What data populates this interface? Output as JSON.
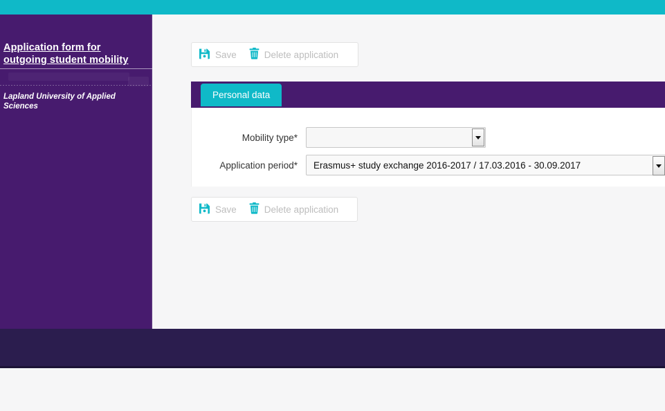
{
  "brand": {
    "teal": "#0fb9c8",
    "purple": "#471b6e",
    "footer_navy": "#2b1d4e"
  },
  "sidebar": {
    "site_title": "Application form for outgoing student mobility",
    "organization": "Lapland University of Applied Sciences"
  },
  "toolbar": {
    "save_label": "Save",
    "delete_label": "Delete application",
    "save_icon": "floppy-disk-icon",
    "delete_icon": "trash-icon"
  },
  "tabs": [
    {
      "label": "Personal data",
      "active": true
    }
  ],
  "form": {
    "fields": [
      {
        "label": "Mobility type*",
        "value": "",
        "control": "select"
      },
      {
        "label": "Application period*",
        "value": "Erasmus+ study exchange 2016-2017 / 17.03.2016 - 30.09.2017",
        "control": "select"
      }
    ]
  }
}
